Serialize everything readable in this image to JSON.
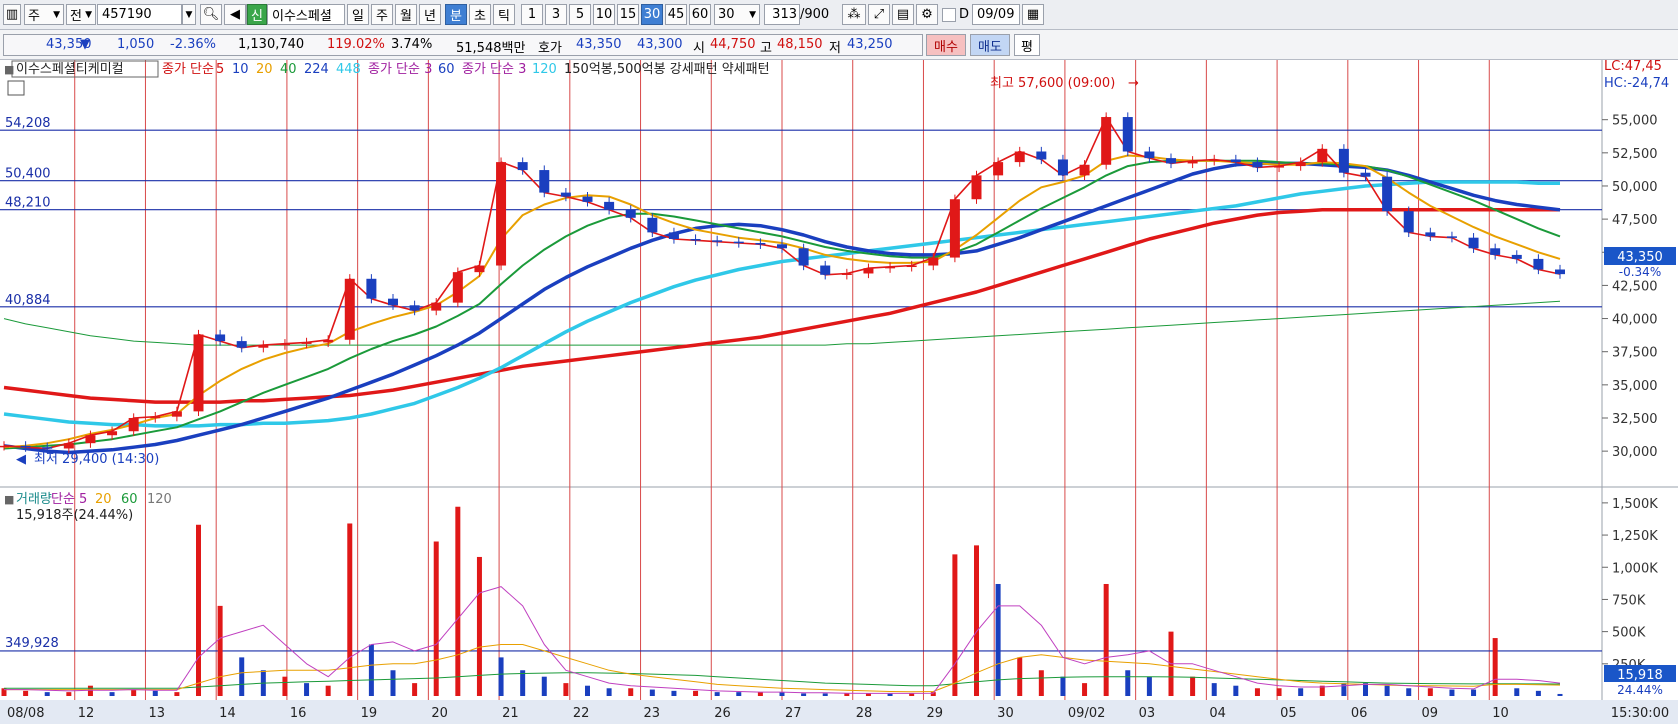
{
  "toolbar": {
    "market": "주",
    "market2": "전",
    "code": "457190",
    "new_badge": "신",
    "stock_name": "이수스페셜",
    "periods": [
      "일",
      "주",
      "월",
      "년",
      "분",
      "초",
      "틱"
    ],
    "active_period": "분",
    "intervals": [
      "1",
      "3",
      "5",
      "10",
      "15",
      "30",
      "45",
      "60"
    ],
    "active_interval": "30",
    "interval_select": "30",
    "count": "313",
    "count_total": "/900",
    "d_label": "D",
    "date": "09/09"
  },
  "quote": {
    "price": "43,350",
    "arrow": "▼",
    "change": "1,050",
    "change_pct": "-2.36%",
    "volume": "1,130,740",
    "vol_ratio": "119.02%",
    "turnover": "3.74%",
    "amount": "51,548백만",
    "hoga_label": "호가",
    "ask": "43,350",
    "bid": "43,300",
    "open_label": "시",
    "open": "44,750",
    "high_label": "고",
    "high": "48,150",
    "low_label": "저",
    "low": "43,250",
    "buy_label": "매수",
    "sell_label": "매도",
    "eval_label": "평"
  },
  "chart_data": [
    {
      "type": "line",
      "title": "이수스페셜티케미컬",
      "legend": [
        {
          "text": "종가 단순",
          "color": "#d01010"
        },
        {
          "text": "5",
          "color": "#d01010"
        },
        {
          "text": "10",
          "color": "#1a3fbf"
        },
        {
          "text": "20",
          "color": "#e8a000"
        },
        {
          "text": "40",
          "color": "#1b9a3a"
        },
        {
          "text": "224",
          "color": "#1a3fbf"
        },
        {
          "text": "448",
          "color": "#2fc8e8"
        },
        {
          "text": "종가 단순 3",
          "color": "#a020a0"
        },
        {
          "text": "60",
          "color": "#1a3fbf"
        },
        {
          "text": "종가 단순 3",
          "color": "#a020a0"
        },
        {
          "text": "120",
          "color": "#2fc8e8"
        },
        {
          "text": "150억봉,500억봉 강세패턴  약세패턴",
          "color": "#222222"
        }
      ],
      "x_labels": [
        "08/08",
        "12",
        "13",
        "14",
        "16",
        "19",
        "20",
        "21",
        "22",
        "23",
        "26",
        "27",
        "28",
        "29",
        "30",
        "09/02",
        "03",
        "04",
        "05",
        "06",
        "09",
        "10"
      ],
      "time_label": "15:30:00",
      "y_ticks": [
        55000,
        52500,
        50000,
        47500,
        45000,
        42500,
        40000,
        37500,
        35000,
        32500,
        30000
      ],
      "y_tick_labels": [
        "55,000",
        "52,500",
        "50,000",
        "47,500",
        "45,000",
        "42,500",
        "40,000",
        "37,500",
        "35,000",
        "32,500",
        "30,000"
      ],
      "ylim": [
        28200,
        59200
      ],
      "hlines": [
        {
          "value": 54208,
          "label": "54,208"
        },
        {
          "value": 50400,
          "label": "50,400"
        },
        {
          "value": 48210,
          "label": "48,210"
        },
        {
          "value": 40884,
          "label": "40,884"
        }
      ],
      "lc_label": "LC:47,45",
      "hc_label": "HC:-24,74",
      "high_annotation": "최고 57,600 (09:00)",
      "low_annotation": "최저 29,400 (14:30)",
      "last_price": "43,350",
      "last_pct": "-0.34%",
      "close": [
        30400,
        30300,
        30200,
        30600,
        31200,
        31500,
        32500,
        32600,
        33000,
        38800,
        38300,
        37800,
        38000,
        38100,
        38200,
        38400,
        43000,
        41500,
        41000,
        40600,
        41200,
        43500,
        44000,
        51800,
        51200,
        49500,
        49200,
        48800,
        48200,
        47600,
        46500,
        46000,
        45900,
        45800,
        45700,
        45600,
        45300,
        44000,
        43300,
        43400,
        43800,
        43900,
        44000,
        44600,
        49000,
        50800,
        51800,
        52600,
        52000,
        50800,
        51600,
        55200,
        52600,
        52100,
        51700,
        51900,
        52000,
        51800,
        51400,
        51500,
        51800,
        52800,
        51000,
        50700,
        48100,
        46500,
        46200,
        46100,
        45300,
        44800,
        44500,
        43700,
        43350
      ],
      "ma_short": {
        "name": "20",
        "color": "#e8a000",
        "values": [
          30300,
          30400,
          30600,
          30900,
          31300,
          31600,
          32000,
          32500,
          32800,
          34200,
          35300,
          36200,
          36900,
          37400,
          37800,
          38100,
          39000,
          39600,
          40100,
          40500,
          41000,
          42000,
          43200,
          46000,
          47800,
          48600,
          49100,
          49300,
          49200,
          48600,
          47800,
          47200,
          46700,
          46400,
          46100,
          45900,
          45700,
          45300,
          44800,
          44500,
          44300,
          44200,
          44200,
          44300,
          45200,
          46300,
          47600,
          48900,
          49900,
          50300,
          50800,
          51900,
          52300,
          52200,
          52000,
          51900,
          51900,
          51800,
          51700,
          51600,
          51600,
          51800,
          51700,
          51500,
          50600,
          49500,
          48500,
          47700,
          46900,
          46200,
          45600,
          45000,
          44500
        ]
      },
      "ma_40": {
        "name": "40",
        "color": "#1b9a3a",
        "values": [
          30200,
          30300,
          30400,
          30500,
          30700,
          30900,
          31200,
          31500,
          31800,
          32400,
          33000,
          33700,
          34400,
          35000,
          35600,
          36200,
          37000,
          37700,
          38300,
          38800,
          39400,
          40200,
          41100,
          42600,
          44000,
          45200,
          46200,
          47000,
          47600,
          47900,
          47900,
          47700,
          47400,
          47100,
          46800,
          46500,
          46200,
          45800,
          45400,
          45100,
          44900,
          44700,
          44600,
          44600,
          45000,
          45600,
          46500,
          47400,
          48300,
          49100,
          49900,
          50800,
          51500,
          51800,
          51900,
          51900,
          51900,
          51900,
          51900,
          51800,
          51700,
          51700,
          51600,
          51500,
          51200,
          50700,
          50100,
          49500,
          48900,
          48200,
          47500,
          46800,
          46200
        ]
      },
      "ma_224": {
        "name": "224",
        "color": "#1a3fbf",
        "values": [
          30400,
          30200,
          30000,
          29900,
          30000,
          30100,
          30300,
          30500,
          30800,
          31200,
          31600,
          32000,
          32500,
          33000,
          33500,
          34000,
          34600,
          35200,
          35800,
          36500,
          37200,
          38000,
          38900,
          40000,
          41100,
          42200,
          43100,
          43900,
          44600,
          45300,
          45900,
          46400,
          46800,
          47000,
          47100,
          47000,
          46700,
          46300,
          45800,
          45400,
          45100,
          44900,
          44800,
          44800,
          44900,
          45100,
          45600,
          46100,
          46700,
          47300,
          47900,
          48500,
          49100,
          49700,
          50300,
          50900,
          51300,
          51600,
          51700,
          51700,
          51700,
          51600,
          51500,
          51400,
          51200,
          50800,
          50300,
          49800,
          49300,
          48900,
          48600,
          48400,
          48200
        ]
      },
      "ma_448": {
        "name": "448",
        "color": "#2fc8e8",
        "values": [
          32800,
          32600,
          32400,
          32200,
          32100,
          32000,
          32000,
          31900,
          31900,
          31900,
          32000,
          32000,
          32100,
          32100,
          32200,
          32300,
          32500,
          32800,
          33200,
          33600,
          34200,
          34800,
          35500,
          36300,
          37200,
          38100,
          39000,
          39800,
          40500,
          41200,
          41800,
          42400,
          42900,
          43300,
          43700,
          44000,
          44300,
          44500,
          44700,
          44900,
          45100,
          45300,
          45500,
          45700,
          45900,
          46100,
          46300,
          46500,
          46700,
          46900,
          47100,
          47300,
          47500,
          47700,
          47900,
          48100,
          48300,
          48500,
          48800,
          49100,
          49400,
          49600,
          49800,
          50000,
          50100,
          50200,
          50300,
          50300,
          50300,
          50300,
          50300,
          50200,
          50200
        ]
      },
      "ma_long": {
        "name": "60",
        "color": "#e01818",
        "values": [
          34800,
          34600,
          34400,
          34200,
          34000,
          33900,
          33800,
          33700,
          33700,
          33700,
          33700,
          33800,
          33800,
          33900,
          34000,
          34100,
          34200,
          34400,
          34600,
          34900,
          35200,
          35500,
          35800,
          36100,
          36400,
          36600,
          36800,
          37000,
          37200,
          37400,
          37600,
          37800,
          38000,
          38200,
          38400,
          38600,
          38900,
          39200,
          39500,
          39800,
          40100,
          40400,
          40800,
          41200,
          41600,
          42000,
          42500,
          43000,
          43500,
          44000,
          44500,
          45000,
          45500,
          46000,
          46400,
          46800,
          47200,
          47500,
          47800,
          48000,
          48100,
          48200,
          48200,
          48200,
          48200,
          48200,
          48200,
          48200,
          48200,
          48200,
          48200,
          48200,
          48200
        ]
      },
      "ma_green_thin": {
        "name": "120",
        "color": "#1b9a3a",
        "values": [
          40000,
          39600,
          39300,
          39000,
          38700,
          38500,
          38300,
          38200,
          38100,
          38000,
          38000,
          38000,
          38000,
          38000,
          38000,
          38000,
          38000,
          38000,
          38000,
          38000,
          38000,
          38000,
          38000,
          38000,
          38000,
          38000,
          38000,
          38000,
          38000,
          38000,
          38000,
          38000,
          38000,
          38000,
          38000,
          38000,
          38000,
          38000,
          38000,
          38100,
          38100,
          38200,
          38300,
          38400,
          38500,
          38600,
          38700,
          38800,
          38900,
          39000,
          39100,
          39200,
          39300,
          39400,
          39500,
          39600,
          39700,
          39800,
          39900,
          40000,
          40100,
          40200,
          40300,
          40400,
          40500,
          40600,
          40700,
          40800,
          40900,
          41000,
          41100,
          41200,
          41300
        ]
      }
    },
    {
      "type": "bar",
      "title": "거래량",
      "legend": [
        {
          "text": "거래량",
          "color": "#1a8a8a"
        },
        {
          "text": "단순 5",
          "color": "#a020a0"
        },
        {
          "text": "20",
          "color": "#e8a000"
        },
        {
          "text": "60",
          "color": "#1b9a3a"
        },
        {
          "text": "120",
          "color": "#777777"
        }
      ],
      "last_volume_text": "15,918주(24.44%)",
      "y_ticks": [
        1500000,
        1250000,
        1000000,
        750000,
        500000,
        250000
      ],
      "y_tick_labels": [
        "1,500K",
        "1,250K",
        "1,000K",
        "750K",
        "500K",
        "250K"
      ],
      "ylim": [
        0,
        1600000
      ],
      "hline": {
        "value": 349928,
        "label": "349,928"
      },
      "last_value": "15,918",
      "last_pct": "24.44%",
      "values": [
        60000,
        40000,
        30000,
        30000,
        80000,
        30000,
        50000,
        40000,
        30000,
        1330000,
        700000,
        300000,
        200000,
        150000,
        100000,
        80000,
        1340000,
        400000,
        200000,
        100000,
        1200000,
        1470000,
        1080000,
        300000,
        200000,
        150000,
        100000,
        80000,
        60000,
        60000,
        50000,
        40000,
        40000,
        30000,
        30000,
        30000,
        30000,
        20000,
        20000,
        20000,
        20000,
        20000,
        20000,
        30000,
        1100000,
        1170000,
        870000,
        300000,
        200000,
        150000,
        100000,
        870000,
        200000,
        150000,
        500000,
        150000,
        100000,
        80000,
        60000,
        60000,
        60000,
        80000,
        100000,
        100000,
        80000,
        60000,
        60000,
        50000,
        50000,
        450000,
        60000,
        40000,
        15918
      ],
      "rising": [
        1,
        1,
        0,
        1,
        1,
        0,
        1,
        0,
        1,
        1,
        1,
        0,
        0,
        1,
        0,
        1,
        1,
        0,
        0,
        1,
        1,
        1,
        1,
        0,
        0,
        0,
        1,
        0,
        0,
        1,
        0,
        0,
        1,
        0,
        0,
        1,
        0,
        0,
        0,
        1,
        1,
        0,
        1,
        1,
        1,
        1,
        0,
        1,
        1,
        0,
        1,
        1,
        0,
        0,
        1,
        1,
        0,
        0,
        1,
        1,
        0,
        1,
        0,
        0,
        0,
        0,
        1,
        0,
        0,
        1,
        0,
        0,
        0
      ],
      "ma_purple": {
        "name": "단순 5",
        "color": "#c040c0",
        "values": [
          50000,
          50000,
          45000,
          40000,
          45000,
          45000,
          50000,
          45000,
          45000,
          300000,
          450000,
          500000,
          550000,
          400000,
          250000,
          150000,
          300000,
          400000,
          420000,
          350000,
          400000,
          600000,
          800000,
          850000,
          700000,
          400000,
          200000,
          150000,
          100000,
          80000,
          70000,
          60000,
          50000,
          40000,
          35000,
          30000,
          30000,
          25000,
          25000,
          22000,
          20000,
          20000,
          20000,
          22000,
          250000,
          500000,
          700000,
          700000,
          550000,
          300000,
          250000,
          300000,
          320000,
          350000,
          250000,
          250000,
          200000,
          150000,
          100000,
          80000,
          70000,
          70000,
          80000,
          90000,
          90000,
          80000,
          70000,
          60000,
          55000,
          130000,
          130000,
          120000,
          100000
        ]
      },
      "ma_orange": {
        "name": "20",
        "color": "#e8a000",
        "values": [
          50000,
          50000,
          50000,
          50000,
          50000,
          50000,
          50000,
          50000,
          50000,
          100000,
          150000,
          180000,
          190000,
          200000,
          200000,
          200000,
          220000,
          240000,
          250000,
          250000,
          280000,
          320000,
          380000,
          400000,
          400000,
          350000,
          300000,
          250000,
          200000,
          170000,
          150000,
          130000,
          110000,
          90000,
          80000,
          70000,
          60000,
          55000,
          50000,
          45000,
          40000,
          35000,
          33000,
          35000,
          100000,
          180000,
          250000,
          300000,
          320000,
          300000,
          280000,
          270000,
          260000,
          250000,
          230000,
          210000,
          190000,
          170000,
          150000,
          130000,
          110000,
          100000,
          95000,
          90000,
          85000,
          80000,
          80000,
          78000,
          75000,
          90000,
          90000,
          88000,
          85000
        ]
      },
      "ma_green": {
        "name": "60",
        "color": "#1b9a3a",
        "values": [
          60000,
          60000,
          60000,
          60000,
          60000,
          60000,
          60000,
          60000,
          60000,
          70000,
          80000,
          90000,
          100000,
          105000,
          110000,
          115000,
          120000,
          125000,
          130000,
          135000,
          140000,
          150000,
          160000,
          170000,
          175000,
          178000,
          180000,
          180000,
          178000,
          175000,
          170000,
          165000,
          160000,
          150000,
          140000,
          130000,
          120000,
          110000,
          100000,
          95000,
          90000,
          85000,
          80000,
          80000,
          95000,
          110000,
          125000,
          135000,
          140000,
          145000,
          148000,
          150000,
          150000,
          150000,
          148000,
          145000,
          140000,
          135000,
          130000,
          125000,
          120000,
          115000,
          110000,
          105000,
          100000,
          98000,
          96000,
          95000,
          94000,
          95000,
          95000,
          94000,
          93000
        ]
      }
    }
  ]
}
